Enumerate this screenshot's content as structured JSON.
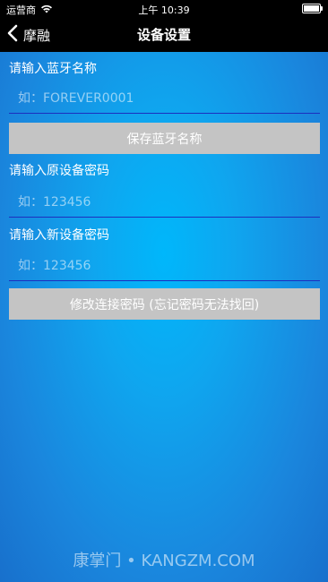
{
  "status_bar": {
    "carrier": "运营商",
    "time": "上午 10:39"
  },
  "nav": {
    "back_label": "摩融",
    "title": "设备设置"
  },
  "bluetooth_name": {
    "label": "请输入蓝牙名称",
    "placeholder": "如：FOREVER0001",
    "value": "",
    "button_label": "保存蓝牙名称"
  },
  "old_password": {
    "label": "请输入原设备密码",
    "placeholder": "如：123456",
    "value": ""
  },
  "new_password": {
    "label": "请输入新设备密码",
    "placeholder": "如：123456",
    "value": "",
    "button_label": "修改连接密码 (忘记密码无法找回)"
  },
  "footer": {
    "watermark": "康掌门 • KANGZM.COM"
  },
  "colors": {
    "accent_blue": "#00b7fb",
    "button_gray": "#c4c4c4",
    "divider": "#1c2fbf"
  },
  "icons": {
    "wifi": "wifi-icon",
    "battery": "battery-icon",
    "back": "chevron-left-icon"
  }
}
